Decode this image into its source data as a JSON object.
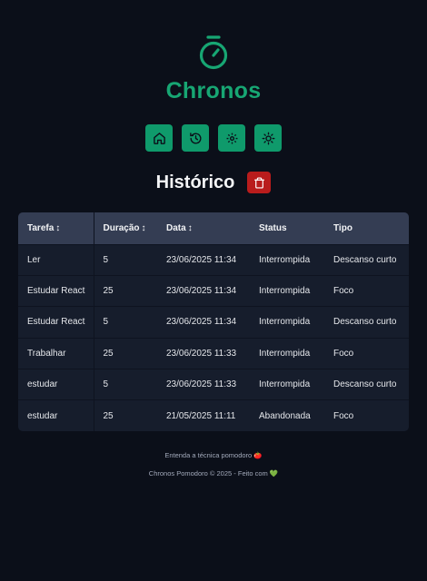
{
  "app": {
    "title": "Chronos",
    "logo_icon": "timer-icon",
    "accent": "#17a673"
  },
  "menu": [
    {
      "icon": "home-icon"
    },
    {
      "icon": "history-icon"
    },
    {
      "icon": "settings-icon"
    },
    {
      "icon": "sun-icon"
    }
  ],
  "history": {
    "title": "Histórico",
    "clear_icon": "trash-icon"
  },
  "table": {
    "columns": [
      {
        "label": "Tarefa",
        "sortable": true
      },
      {
        "label": "Duração",
        "sortable": true
      },
      {
        "label": "Data",
        "sortable": true
      },
      {
        "label": "Status",
        "sortable": false
      },
      {
        "label": "Tipo",
        "sortable": false
      }
    ],
    "sort_glyph": "↕",
    "rows": [
      [
        "Ler",
        "5",
        "23/06/2025 11:34",
        "Interrompida",
        "Descanso curto"
      ],
      [
        "Estudar React",
        "25",
        "23/06/2025 11:34",
        "Interrompida",
        "Foco"
      ],
      [
        "Estudar React",
        "5",
        "23/06/2025 11:34",
        "Interrompida",
        "Descanso curto"
      ],
      [
        "Trabalhar",
        "25",
        "23/06/2025 11:33",
        "Interrompida",
        "Foco"
      ],
      [
        "estudar",
        "5",
        "23/06/2025 11:33",
        "Interrompida",
        "Descanso curto"
      ],
      [
        "estudar",
        "25",
        "21/05/2025 11:11",
        "Abandonada",
        "Foco"
      ]
    ]
  },
  "footer": {
    "link_text": "Entenda a técnica pomodoro 🍅",
    "copyright": "Chronos Pomodoro © 2025 - Feito com 💚"
  }
}
